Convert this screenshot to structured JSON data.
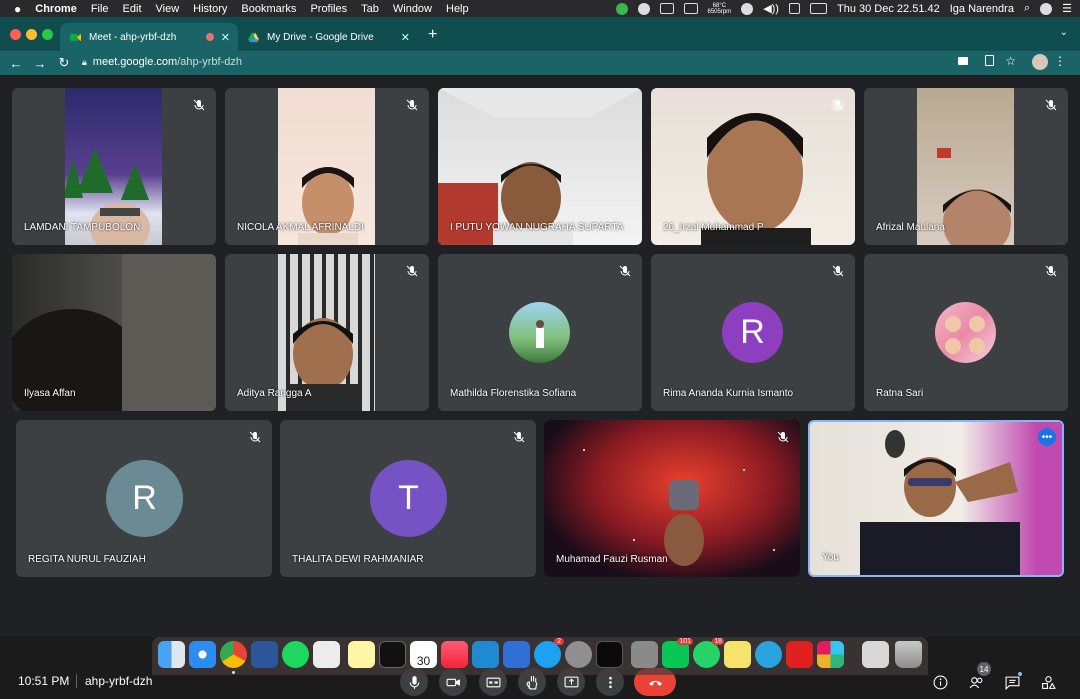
{
  "menubar": {
    "app_name": "Chrome",
    "items": [
      "File",
      "Edit",
      "View",
      "History",
      "Bookmarks",
      "Profiles",
      "Tab",
      "Window",
      "Help"
    ],
    "weather_temp": "68°C",
    "weather_rpm": "6505rpm",
    "datetime": "Thu 30 Dec  22.51.42",
    "user": "Iga Narendra"
  },
  "tabs": [
    {
      "title": "Meet - ahp-yrbf-dzh",
      "active": true
    },
    {
      "title": "My Drive - Google Drive",
      "active": false
    }
  ],
  "omnibox": {
    "host": "meet.google.com",
    "path": "/ahp-yrbf-dzh"
  },
  "participants": [
    {
      "name": "LAMDANI TAMPUBOLON",
      "type": "video",
      "muted": true
    },
    {
      "name": "NICOLA AKMAL AFRINALDI",
      "type": "video",
      "muted": true
    },
    {
      "name": "I PUTU YOWAN NUGRAHA SUPARTA",
      "type": "video",
      "muted": false
    },
    {
      "name": "26_Irzal Muhammad P",
      "type": "video",
      "muted": true
    },
    {
      "name": "Afrizal Maulana",
      "type": "video",
      "muted": true
    },
    {
      "name": "Ilyasa Affan",
      "type": "video",
      "muted": false
    },
    {
      "name": "Aditya Rangga A",
      "type": "video",
      "muted": true
    },
    {
      "name": "Mathilda Florenstika Sofiana",
      "type": "photo",
      "muted": true
    },
    {
      "name": "Rima Ananda Kurnia Ismanto",
      "type": "initial",
      "initial": "R",
      "color": "#8e3fbf",
      "muted": true
    },
    {
      "name": "Ratna Sari",
      "type": "photo",
      "muted": true
    },
    {
      "name": "REGITA NURUL FAUZIAH",
      "type": "initial",
      "initial": "R",
      "color": "#6a8a94",
      "muted": true
    },
    {
      "name": "THALITA DEWI RAHMANIAR",
      "type": "initial",
      "initial": "T",
      "color": "#7553c4",
      "muted": true
    },
    {
      "name": "Muhamad Fauzi Rusman",
      "type": "video",
      "muted": true
    },
    {
      "name": "You",
      "type": "video",
      "muted": false
    }
  ],
  "footer": {
    "time": "10:51 PM",
    "meeting_code": "ahp-yrbf-dzh",
    "people_count": "14"
  },
  "dock_badges": {
    "calendar_day": "30",
    "appstore": "2",
    "line": "101",
    "whatsapp": "18"
  },
  "colors": {
    "tabbar": "#0f4d4f",
    "meet_bg": "#202124",
    "tile": "#3c4043",
    "end_call": "#ea4335",
    "accent": "#8ab4f8"
  }
}
